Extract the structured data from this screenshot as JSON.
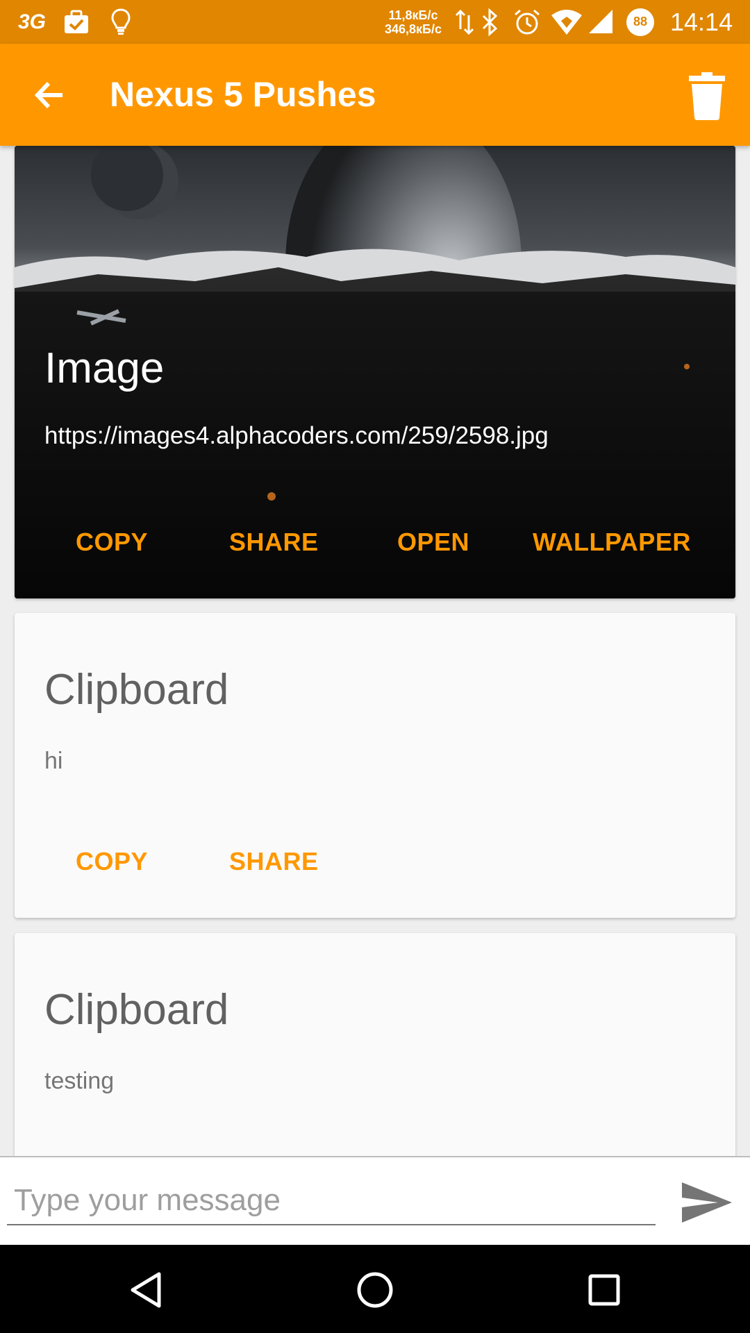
{
  "status_bar": {
    "network": "3G",
    "upload_speed": "11,8кБ/с",
    "download_speed": "346,8кБ/с",
    "battery": "88",
    "time": "14:14"
  },
  "app_bar": {
    "title": "Nexus 5 Pushes",
    "back_icon": "arrow-back-icon",
    "delete_icon": "trash-icon"
  },
  "cards": [
    {
      "type": "image",
      "title": "Image",
      "text": "https://images4.alphacoders.com/259/2598.jpg",
      "actions": [
        "COPY",
        "SHARE",
        "OPEN",
        "WALLPAPER"
      ]
    },
    {
      "type": "clipboard",
      "title": "Clipboard",
      "text": "hi",
      "actions": [
        "COPY",
        "SHARE"
      ]
    },
    {
      "type": "clipboard",
      "title": "Clipboard",
      "text": "testing",
      "actions": []
    }
  ],
  "message_bar": {
    "placeholder": "Type your message",
    "value": "",
    "send_icon": "send-icon"
  },
  "nav_bar": {
    "icons": [
      "back-triangle-icon",
      "home-circle-icon",
      "recents-square-icon"
    ]
  },
  "colors": {
    "status_bar": "#e08600",
    "app_bar": "#ff9800",
    "accent": "#ff9800"
  }
}
